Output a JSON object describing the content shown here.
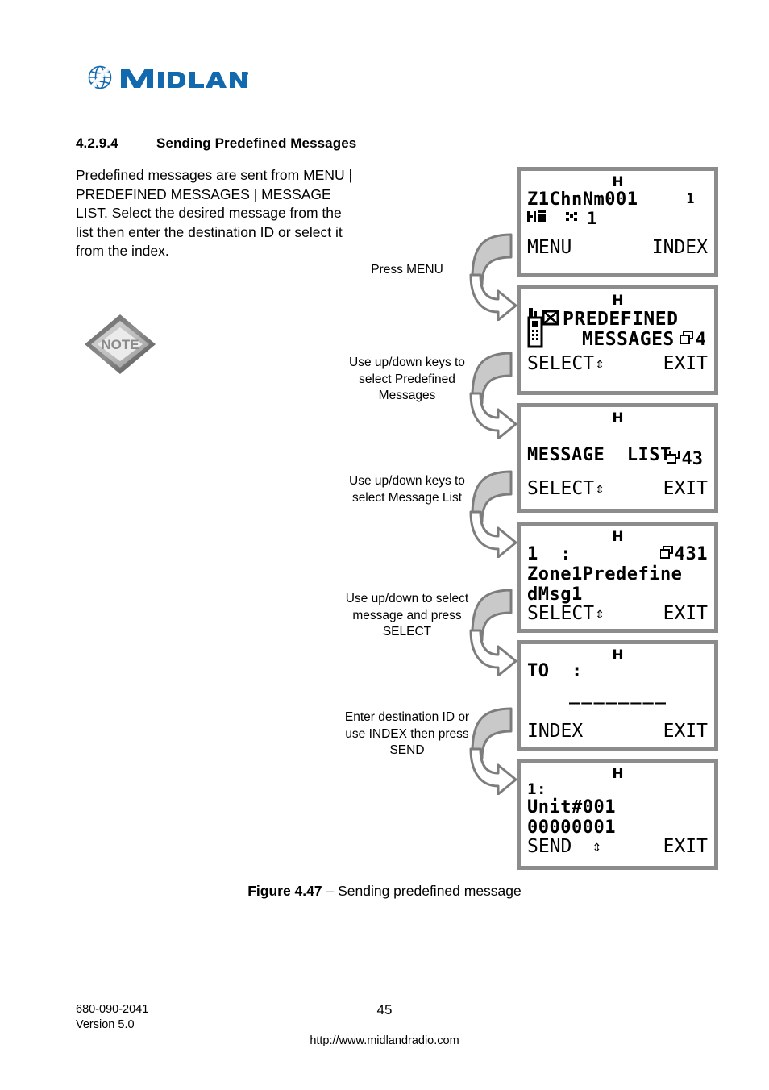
{
  "brand": {
    "name": "MIDLAND",
    "color": "#1269ae",
    "globe_icon": "globe-icon"
  },
  "heading": {
    "number": "4.2.9.4",
    "title": "Sending Predefined Messages"
  },
  "body": {
    "paragraph": "Predefined messages are sent from MENU | PREDEFINED MESSAGES | MESSAGE LIST. Select the desired message from the list then enter the destination ID or select it from the index."
  },
  "note": {
    "label": "NOTE",
    "icon": "note-diamond-icon"
  },
  "steps": [
    {
      "label": "Press MENU",
      "arrow_icon": "curved-arrow-icon"
    },
    {
      "label": "Use up/down keys to select Predefined Messages",
      "arrow_icon": "curved-arrow-icon"
    },
    {
      "label": "Use up/down keys to select Message List",
      "arrow_icon": "curved-arrow-icon"
    },
    {
      "label": "Use up/down to select message and press SELECT",
      "arrow_icon": "curved-arrow-icon"
    },
    {
      "label": "Enter destination ID or use INDEX then press SEND",
      "arrow_icon": "curved-arrow-icon"
    }
  ],
  "screens": [
    {
      "name": "home-screen",
      "header": "H",
      "line1": "Z1ChnNm001",
      "line1_right": "1",
      "status_icons": [
        "signal-bars-icon",
        "antenna-icon"
      ],
      "status_value": "1",
      "softkey_left": "MENU",
      "softkey_right": "INDEX",
      "updown": false
    },
    {
      "name": "predefined-messages-menu",
      "header": "H",
      "menu_icon": "radio-envelope-icon",
      "badge": "4",
      "line1": "PREDEFINED",
      "line2": "MESSAGES",
      "softkey_left": "SELECT",
      "softkey_right": "EXIT",
      "updown": true
    },
    {
      "name": "message-list-menu",
      "header": "H",
      "badge": "43",
      "line1": "MESSAGE  LIST",
      "softkey_left": "SELECT",
      "softkey_right": "EXIT",
      "updown": true
    },
    {
      "name": "message-entry-screen",
      "header": "H",
      "line1": "1  :",
      "badge": "431",
      "line2": "Zone1Predefine",
      "line3": "dMsg1",
      "softkey_left": "SELECT",
      "softkey_right": "EXIT",
      "updown": true
    },
    {
      "name": "destination-entry-screen",
      "header": "H",
      "line1": "TO  :",
      "line2": "________",
      "softkey_left": "INDEX",
      "softkey_right": "EXIT",
      "updown": false
    },
    {
      "name": "send-confirm-screen",
      "header": "H",
      "line1": "1:",
      "line2": "Unit#001",
      "line3": "00000001",
      "softkey_left": "SEND",
      "softkey_right": "EXIT",
      "updown": true
    }
  ],
  "figure": {
    "label": "Figure 4.47",
    "dash": " – ",
    "text": "Sending predefined message"
  },
  "footer": {
    "doc_number": "680-090-2041",
    "version": "Version 5.0",
    "page": "45",
    "url": "http://www.midlandradio.com"
  }
}
